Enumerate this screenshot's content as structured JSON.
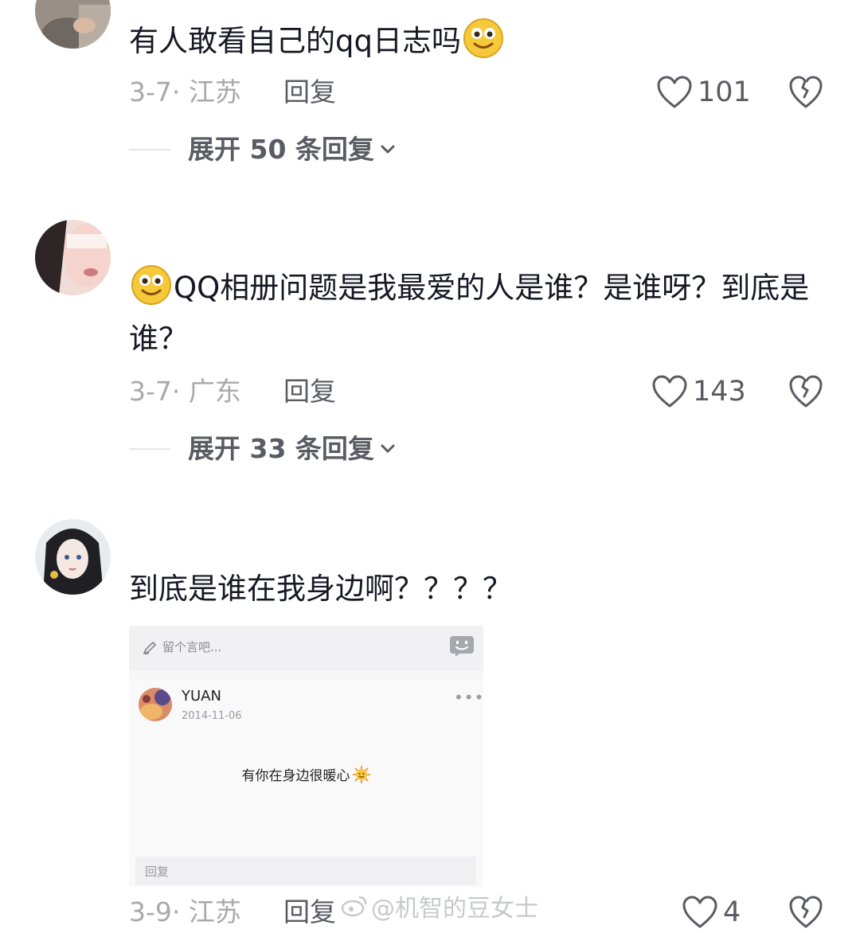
{
  "comments": [
    {
      "text": "有人敢看自己的qq日志吗",
      "emoji": "smile-emoji",
      "date_location": "3-7· 江苏",
      "reply_label": "回复",
      "likes": "101",
      "expand_label": "展开 50 条回复"
    },
    {
      "text": "QQ相册问题是我最爱的人是谁？是谁呀？到底是谁？",
      "emoji": "smile-emoji",
      "date_location": "3-7· 广东",
      "reply_label": "回复",
      "likes": "143",
      "expand_label": "展开 33 条回复"
    },
    {
      "text": "到底是谁在我身边啊？？？？",
      "date_location": "3-9· 江苏",
      "reply_label": "回复",
      "likes": "4",
      "attachment": {
        "input_placeholder": "留个言吧...",
        "author": "YUAN",
        "date": "2014-11-06",
        "message": "有你在身边很暖心",
        "message_emoji": "sun-emoji",
        "reply_placeholder": "回复"
      }
    }
  ],
  "watermark": "@机智的豆女士",
  "colors": {
    "primary_text": "#161823",
    "secondary_text": "#a8a9ae",
    "action_text": "#5a5b63"
  }
}
